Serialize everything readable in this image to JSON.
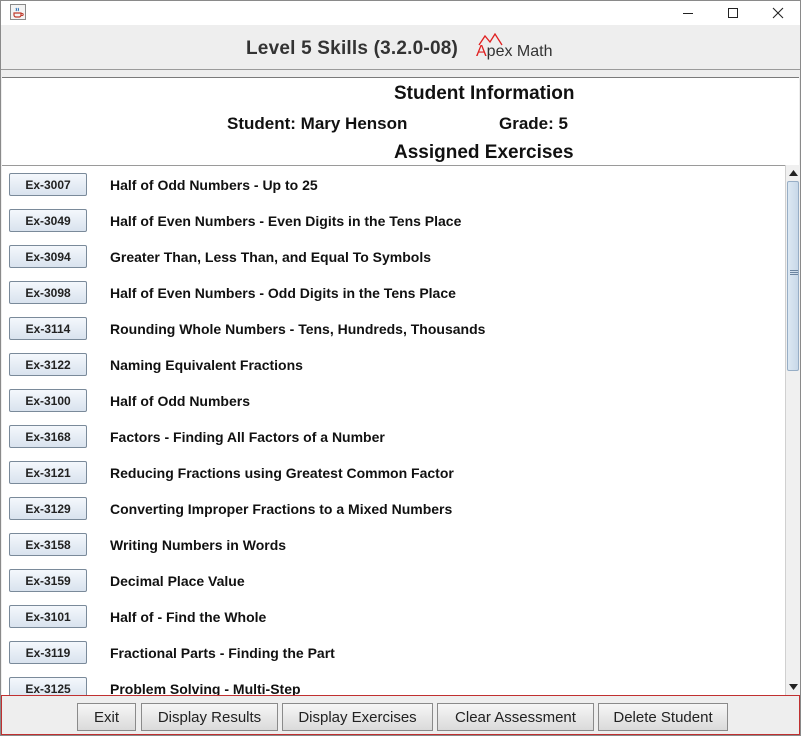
{
  "window": {
    "app_icon": "java-coffee-icon",
    "controls": [
      "minimize-icon",
      "maximize-icon",
      "close-icon"
    ]
  },
  "header": {
    "title": "Level 5 Skills  (3.2.0-08)",
    "logo_first_letter": "A",
    "logo_rest": "pex Math",
    "logo_accent": "#e02020"
  },
  "student_info": {
    "heading": "Student Information",
    "student": "Student:  Mary Henson",
    "grade": "Grade:  5",
    "assigned_heading": "Assigned Exercises"
  },
  "exercises": [
    {
      "code": "Ex-3007",
      "title": "Half of Odd Numbers - Up to 25"
    },
    {
      "code": "Ex-3049",
      "title": "Half of Even Numbers - Even Digits in the Tens Place"
    },
    {
      "code": "Ex-3094",
      "title": "Greater Than, Less Than, and Equal To Symbols"
    },
    {
      "code": "Ex-3098",
      "title": "Half of Even Numbers - Odd Digits in the Tens Place"
    },
    {
      "code": "Ex-3114",
      "title": "Rounding Whole Numbers - Tens, Hundreds, Thousands"
    },
    {
      "code": "Ex-3122",
      "title": "Naming Equivalent Fractions"
    },
    {
      "code": "Ex-3100",
      "title": "Half of Odd Numbers"
    },
    {
      "code": "Ex-3168",
      "title": "Factors - Finding All Factors of a Number"
    },
    {
      "code": "Ex-3121",
      "title": "Reducing Fractions using Greatest Common Factor"
    },
    {
      "code": "Ex-3129",
      "title": "Converting Improper Fractions to a Mixed Numbers"
    },
    {
      "code": "Ex-3158",
      "title": "Writing Numbers in Words"
    },
    {
      "code": "Ex-3159",
      "title": "Decimal Place Value"
    },
    {
      "code": "Ex-3101",
      "title": "Half of - Find the Whole"
    },
    {
      "code": "Ex-3119",
      "title": "Fractional Parts - Finding the Part"
    },
    {
      "code": "Ex-3125",
      "title": "Problem Solving - Multi-Step"
    }
  ],
  "footer": {
    "exit": "Exit",
    "display_results": "Display Results",
    "display_exercises": "Display Exercises",
    "clear_assessment": "Clear Assessment",
    "delete_student": "Delete Student"
  },
  "colors": {
    "footer_border": "#c03030",
    "exercise_button": "#dce6f0"
  }
}
